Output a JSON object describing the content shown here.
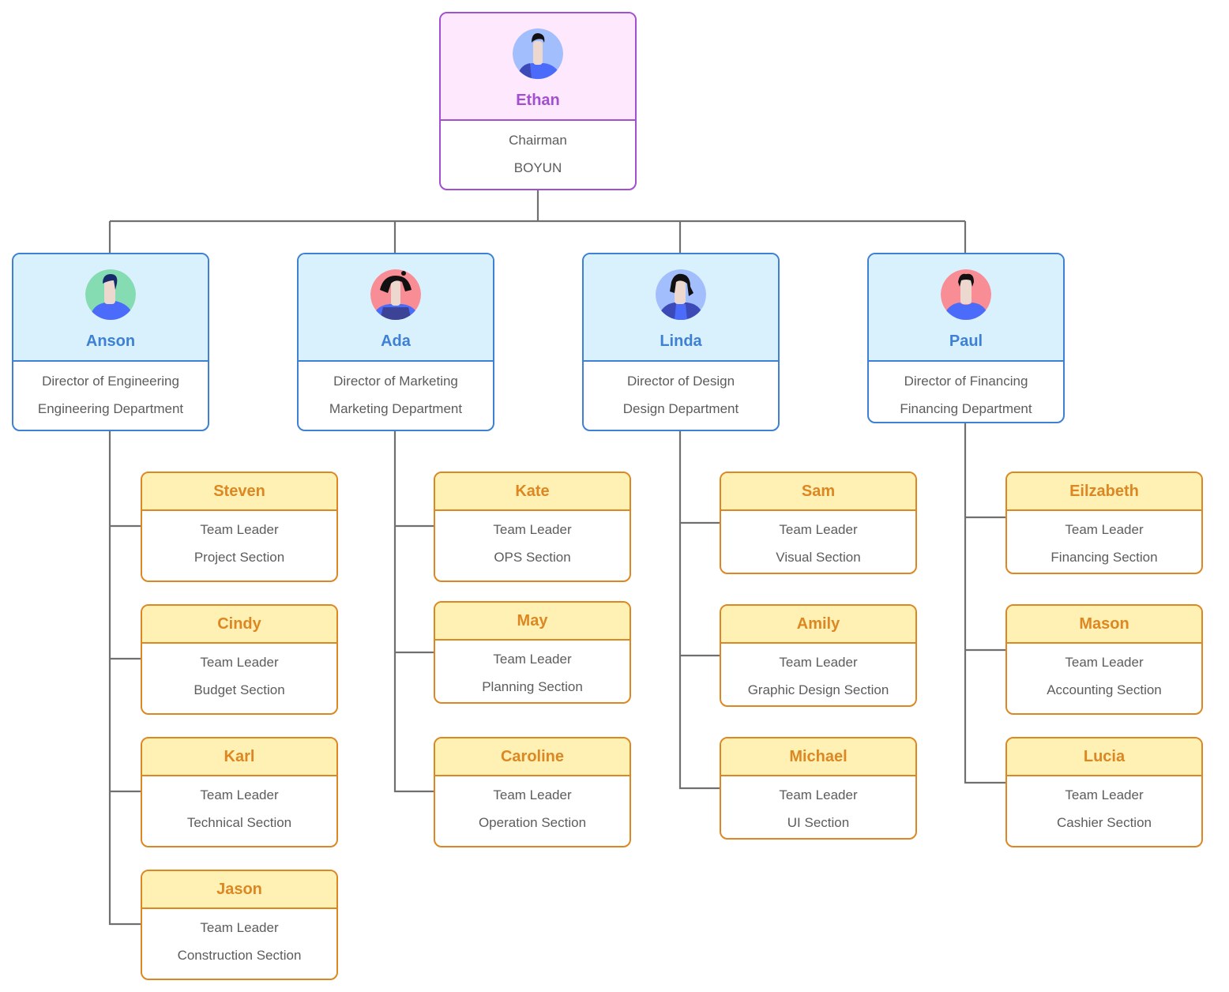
{
  "colors": {
    "chairman_border": "#a24fd0",
    "chairman_header": "#fde8fd",
    "director_border": "#3d80d4",
    "director_header": "#d9f1fd",
    "leader_border": "#dd8723",
    "leader_header": "#fff0b4",
    "connector": "#707070",
    "body_text": "#5c5c5c"
  },
  "chairman": {
    "name": "Ethan",
    "title": "Chairman",
    "org": "BOYUN",
    "avatar": {
      "icon": "male-avatar-icon",
      "bg": "#a3befd"
    }
  },
  "directors": [
    {
      "name": "Anson",
      "title": "Director of Engineering",
      "department": "Engineering Department",
      "avatar": {
        "icon": "male-avatar-icon",
        "bg": "#86dcb2"
      },
      "leaders": [
        {
          "name": "Steven",
          "title": "Team Leader",
          "section": "Project Section"
        },
        {
          "name": "Cindy",
          "title": "Team Leader",
          "section": "Budget Section"
        },
        {
          "name": "Karl",
          "title": "Team Leader",
          "section": "Technical Section"
        },
        {
          "name": "Jason",
          "title": "Team Leader",
          "section": "Construction Section"
        }
      ]
    },
    {
      "name": "Ada",
      "title": "Director of Marketing",
      "department": "Marketing Department",
      "avatar": {
        "icon": "female-avatar-icon",
        "bg": "#f98d95"
      },
      "leaders": [
        {
          "name": "Kate",
          "title": "Team Leader",
          "section": "OPS Section"
        },
        {
          "name": "May",
          "title": "Team Leader",
          "section": "Planning Section"
        },
        {
          "name": "Caroline",
          "title": "Team Leader",
          "section": "Operation Section"
        }
      ]
    },
    {
      "name": "Linda",
      "title": "Director of Design",
      "department": "Design Department",
      "avatar": {
        "icon": "female-avatar-icon",
        "bg": "#a3befd"
      },
      "leaders": [
        {
          "name": "Sam",
          "title": "Team Leader",
          "section": "Visual Section"
        },
        {
          "name": "Amily",
          "title": "Team Leader",
          "section": "Graphic Design Section"
        },
        {
          "name": "Michael",
          "title": "Team Leader",
          "section": "UI Section"
        }
      ]
    },
    {
      "name": "Paul",
      "title": "Director of Financing",
      "department": "Financing Department",
      "avatar": {
        "icon": "male-avatar-icon",
        "bg": "#f98d95"
      },
      "leaders": [
        {
          "name": "Eilzabeth",
          "title": "Team Leader",
          "section": "Financing Section"
        },
        {
          "name": "Mason",
          "title": "Team Leader",
          "section": "Accounting Section"
        },
        {
          "name": "Lucia",
          "title": "Team Leader",
          "section": "Cashier Section"
        }
      ]
    }
  ]
}
